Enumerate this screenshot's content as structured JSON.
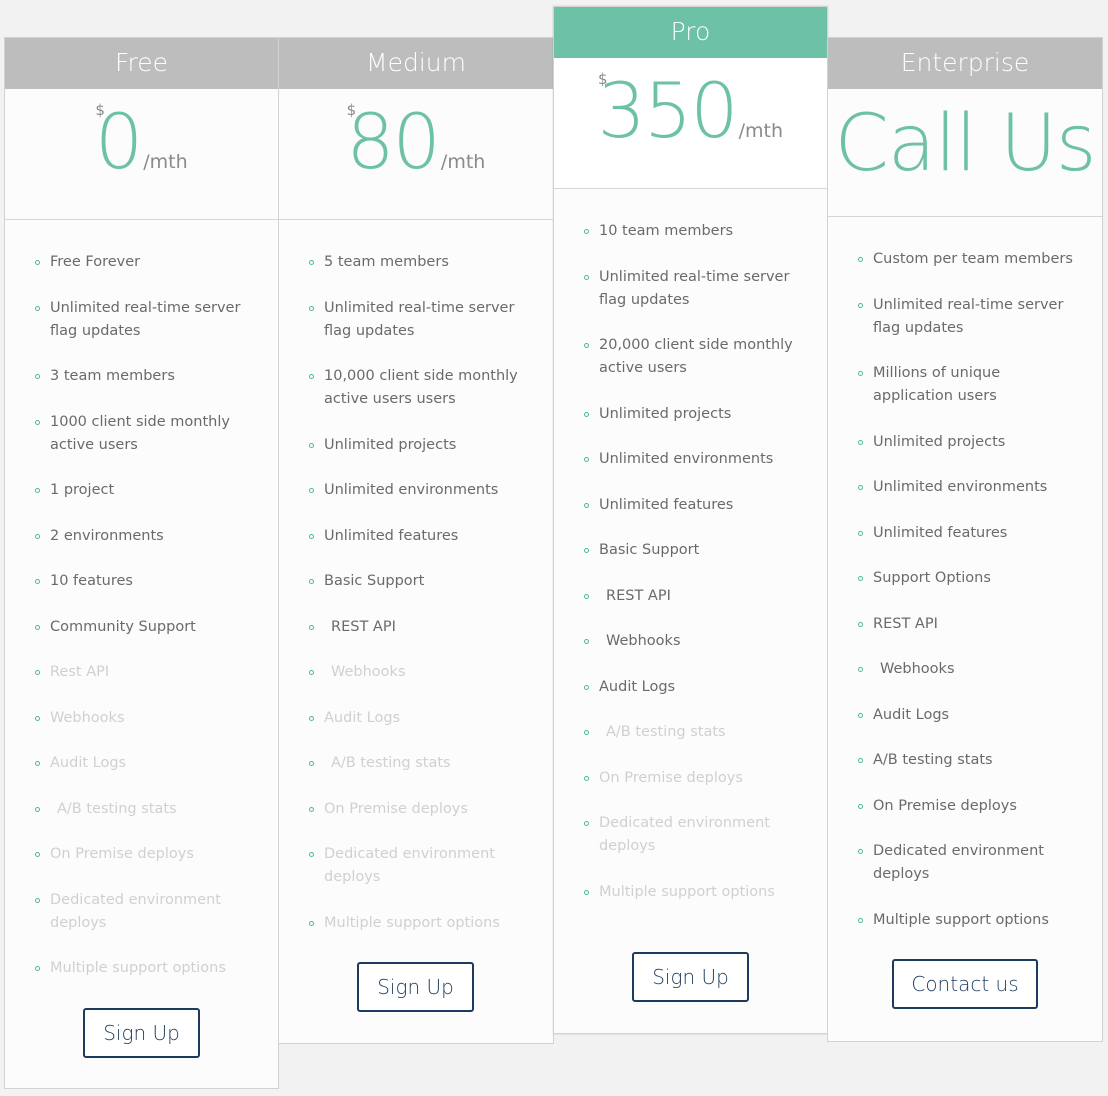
{
  "colors": {
    "accent": "#6cc1a6",
    "header_gray": "#bdbdbd",
    "button_border": "#1d3b5c",
    "background": "#f2f2f2"
  },
  "plans": [
    {
      "name": "Free",
      "currency": "$",
      "price": "0",
      "period": "/mth",
      "button": "Sign Up",
      "features": [
        {
          "text": "Free Forever",
          "included": true
        },
        {
          "text": "Unlimited real-time server flag updates",
          "included": true
        },
        {
          "text": "3 team members",
          "included": true
        },
        {
          "text": "1000 client side monthly active users",
          "included": true
        },
        {
          "text": "1 project",
          "included": true
        },
        {
          "text": "2 environments",
          "included": true
        },
        {
          "text": "10 features",
          "included": true
        },
        {
          "text": "Community Support",
          "included": true
        },
        {
          "text": "Rest API",
          "included": false
        },
        {
          "text": "Webhooks",
          "included": false
        },
        {
          "text": "Audit Logs",
          "included": false
        },
        {
          "text": "A/B testing stats",
          "included": false
        },
        {
          "text": "On Premise deploys",
          "included": false
        },
        {
          "text": "Dedicated environment deploys",
          "included": false
        },
        {
          "text": "Multiple support options",
          "included": false
        }
      ]
    },
    {
      "name": "Medium",
      "currency": "$",
      "price": "80",
      "period": "/mth",
      "button": "Sign Up",
      "features": [
        {
          "text": "5 team members",
          "included": true
        },
        {
          "text": "Unlimited real-time server flag updates",
          "included": true
        },
        {
          "text": "10,000 client side monthly active users users",
          "included": true
        },
        {
          "text": "Unlimited projects",
          "included": true
        },
        {
          "text": "Unlimited environments",
          "included": true
        },
        {
          "text": "Unlimited features",
          "included": true
        },
        {
          "text": "Basic Support",
          "included": true
        },
        {
          "text": "REST API",
          "included": true
        },
        {
          "text": "Webhooks",
          "included": false
        },
        {
          "text": "Audit Logs",
          "included": false
        },
        {
          "text": "A/B testing stats",
          "included": false
        },
        {
          "text": "On Premise deploys",
          "included": false
        },
        {
          "text": "Dedicated environment deploys",
          "included": false
        },
        {
          "text": "Multiple support options",
          "included": false
        }
      ]
    },
    {
      "name": "Pro",
      "featured": true,
      "currency": "$",
      "price": "350",
      "period": "/mth",
      "button": "Sign Up",
      "features": [
        {
          "text": "10 team members",
          "included": true
        },
        {
          "text": "Unlimited real-time server flag updates",
          "included": true
        },
        {
          "text": "20,000 client side monthly active users",
          "included": true
        },
        {
          "text": "Unlimited projects",
          "included": true
        },
        {
          "text": "Unlimited environments",
          "included": true
        },
        {
          "text": "Unlimited features",
          "included": true
        },
        {
          "text": "Basic Support",
          "included": true
        },
        {
          "text": "REST API",
          "included": true
        },
        {
          "text": "Webhooks",
          "included": true
        },
        {
          "text": "Audit Logs",
          "included": true
        },
        {
          "text": "A/B testing stats",
          "included": false
        },
        {
          "text": "On Premise deploys",
          "included": false
        },
        {
          "text": "Dedicated environment deploys",
          "included": false
        },
        {
          "text": "Multiple support options",
          "included": false
        }
      ]
    },
    {
      "name": "Enterprise",
      "price_text": "Call Us",
      "button": "Contact us",
      "features": [
        {
          "text": "Custom per team members",
          "included": true
        },
        {
          "text": "Unlimited real-time server flag updates",
          "included": true
        },
        {
          "text": "Millions of unique application users",
          "included": true
        },
        {
          "text": "Unlimited projects",
          "included": true
        },
        {
          "text": "Unlimited environments",
          "included": true
        },
        {
          "text": "Unlimited features",
          "included": true
        },
        {
          "text": "Support Options",
          "included": true
        },
        {
          "text": "REST API",
          "included": true
        },
        {
          "text": "Webhooks",
          "included": true
        },
        {
          "text": "Audit Logs",
          "included": true
        },
        {
          "text": "A/B testing stats",
          "included": true
        },
        {
          "text": "On Premise deploys",
          "included": true
        },
        {
          "text": "Dedicated environment deploys",
          "included": true
        },
        {
          "text": "Multiple support options",
          "included": true
        }
      ]
    }
  ]
}
